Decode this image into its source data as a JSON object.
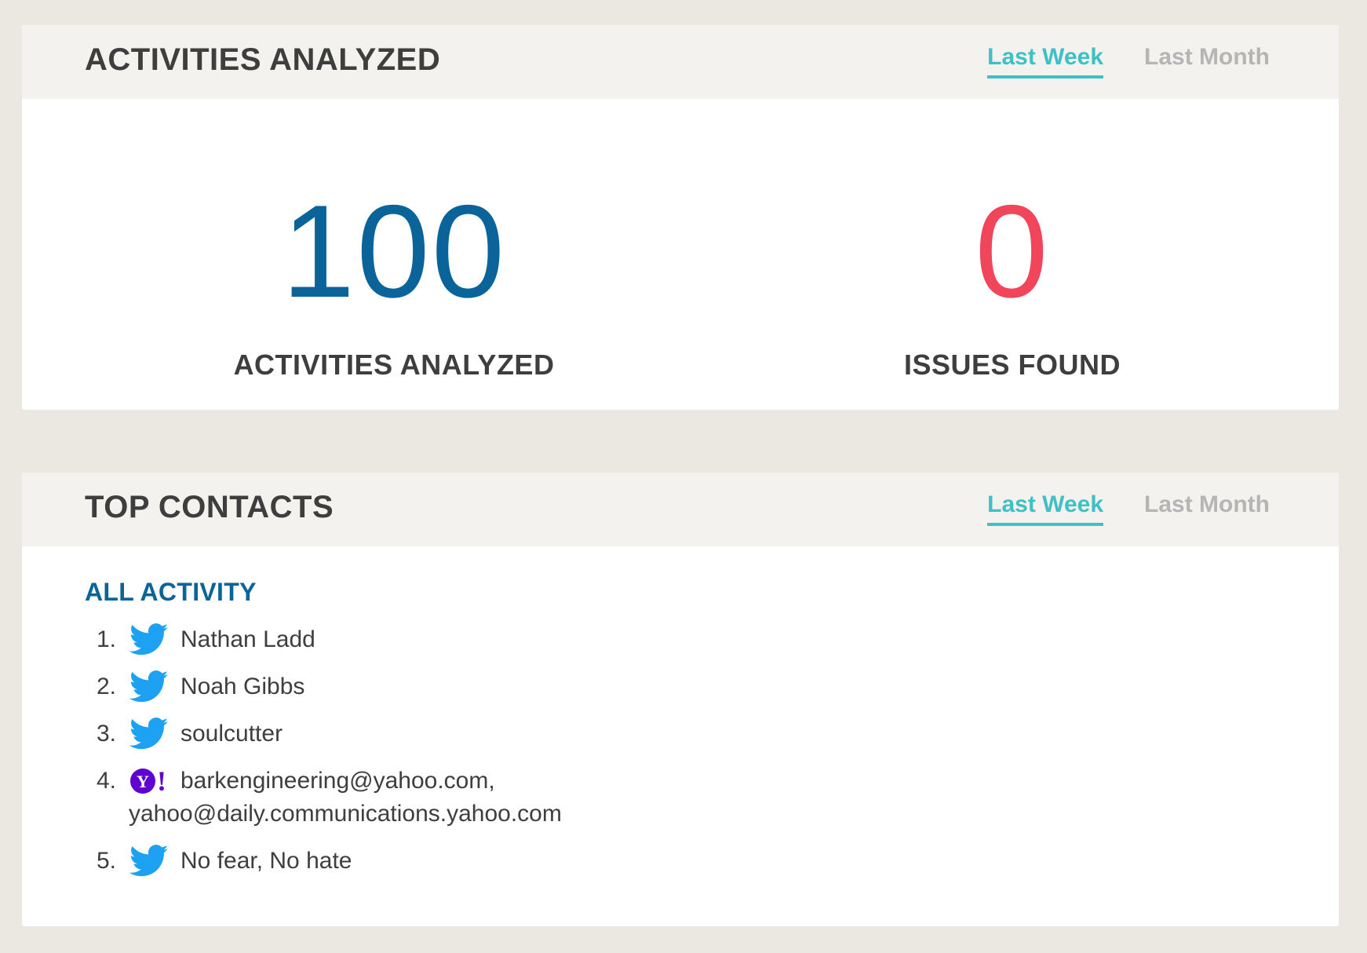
{
  "activities_panel": {
    "title": "ACTIVITIES ANALYZED",
    "tabs": [
      {
        "label": "Last Week",
        "active": true
      },
      {
        "label": "Last Month",
        "active": false
      }
    ],
    "stats": {
      "activities": {
        "value": "100",
        "label": "ACTIVITIES ANALYZED",
        "color": "#0a6499"
      },
      "issues": {
        "value": "0",
        "label": "ISSUES FOUND",
        "color": "#f0455b"
      }
    }
  },
  "contacts_panel": {
    "title": "TOP CONTACTS",
    "tabs": [
      {
        "label": "Last Week",
        "active": true
      },
      {
        "label": "Last Month",
        "active": false
      }
    ],
    "section_title": "ALL ACTIVITY",
    "contacts": [
      {
        "num": "1.",
        "icon": "twitter-icon",
        "name": "Nathan Ladd"
      },
      {
        "num": "2.",
        "icon": "twitter-icon",
        "name": "Noah Gibbs"
      },
      {
        "num": "3.",
        "icon": "twitter-icon",
        "name": "soulcutter"
      },
      {
        "num": "4.",
        "icon": "yahoo-icon",
        "name_line1": "barkengineering@yahoo.com,",
        "name_line2": "yahoo@daily.communications.yahoo.com"
      },
      {
        "num": "5.",
        "icon": "twitter-icon",
        "name": "No fear, No hate"
      }
    ]
  },
  "colors": {
    "accent_tab": "#3ec0c4",
    "primary_blue": "#0a6499",
    "alert_red": "#f0455b",
    "twitter_blue": "#1da1f2",
    "yahoo_purple": "#5f01d1"
  }
}
